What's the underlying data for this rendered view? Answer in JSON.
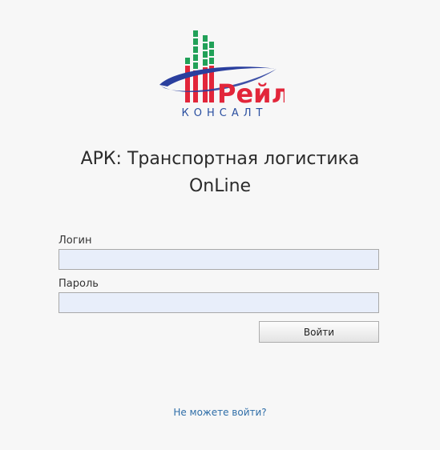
{
  "logo": {
    "brand_text": "Рейл",
    "company_text": "КОНСАЛТ",
    "colors": {
      "red": "#e2263a",
      "green": "#21a158",
      "blue": "#2a3f9e"
    }
  },
  "header": {
    "title_line1": "АРК: Транспортная логистика",
    "title_line2": "OnLine"
  },
  "form": {
    "login_label": "Логин",
    "login_value": "",
    "password_label": "Пароль",
    "password_value": "",
    "submit_label": "Войти"
  },
  "footer": {
    "help_link": "Не можете войти?"
  },
  "colors": {
    "background": "#f7f7f7",
    "input_background": "#e8eefa",
    "link": "#2f6ea8"
  }
}
